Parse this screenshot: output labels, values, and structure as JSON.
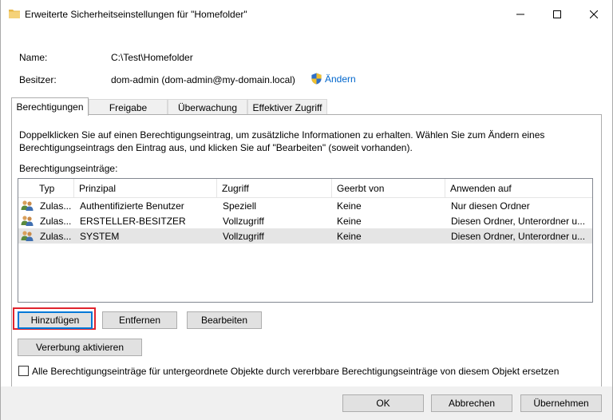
{
  "window": {
    "title": "Erweiterte Sicherheitseinstellungen für \"Homefolder\"",
    "icon": "folder-icon",
    "controls": [
      "minimize-icon",
      "maximize-icon",
      "close-icon"
    ]
  },
  "info": {
    "name_label": "Name:",
    "name_value": "C:\\Test\\Homefolder",
    "owner_label": "Besitzer:",
    "owner_value": "dom-admin (dom-admin@my-domain.local)",
    "change_label": "Ändern",
    "change_icon": "shield-icon"
  },
  "tabs": [
    {
      "label": "Berechtigungen",
      "active": true
    },
    {
      "label": "Freigabe",
      "active": false
    },
    {
      "label": "Überwachung",
      "active": false
    },
    {
      "label": "Effektiver Zugriff",
      "active": false
    }
  ],
  "panel": {
    "description_line1": "Doppelklicken Sie auf einen Berechtigungseintrag, um zusätzliche Informationen zu erhalten. Wählen Sie zum Ändern eines",
    "description_line2": "Berechtigungseintrags den Eintrag aus, und klicken Sie auf \"Bearbeiten\" (soweit vorhanden).",
    "entries_label": "Berechtigungseinträge:"
  },
  "table": {
    "columns": [
      "Typ",
      "Prinzipal",
      "Zugriff",
      "Geerbt von",
      "Anwenden auf"
    ],
    "rows": [
      {
        "type": "Zulas...",
        "principal": "Authentifizierte Benutzer",
        "access": "Speziell",
        "inherited": "Keine",
        "applies": "Nur diesen Ordner",
        "selected": false
      },
      {
        "type": "Zulas...",
        "principal": "ERSTELLER-BESITZER",
        "access": "Vollzugriff",
        "inherited": "Keine",
        "applies": "Diesen Ordner, Unterordner u...",
        "selected": false
      },
      {
        "type": "Zulas...",
        "principal": "SYSTEM",
        "access": "Vollzugriff",
        "inherited": "Keine",
        "applies": "Diesen Ordner, Unterordner u...",
        "selected": true
      }
    ]
  },
  "buttons": {
    "add": "Hinzufügen",
    "remove": "Entfernen",
    "edit": "Bearbeiten",
    "inheritance": "Vererbung aktivieren",
    "ok": "OK",
    "cancel": "Abbrechen",
    "apply": "Übernehmen"
  },
  "checkbox": {
    "label": "Alle Berechtigungseinträge für untergeordnete Objekte durch vererbbare Berechtigungseinträge von diesem Objekt ersetzen",
    "checked": false
  },
  "colors": {
    "highlight": "#e0242e",
    "link": "#0066cc",
    "focus": "#0078d7"
  }
}
